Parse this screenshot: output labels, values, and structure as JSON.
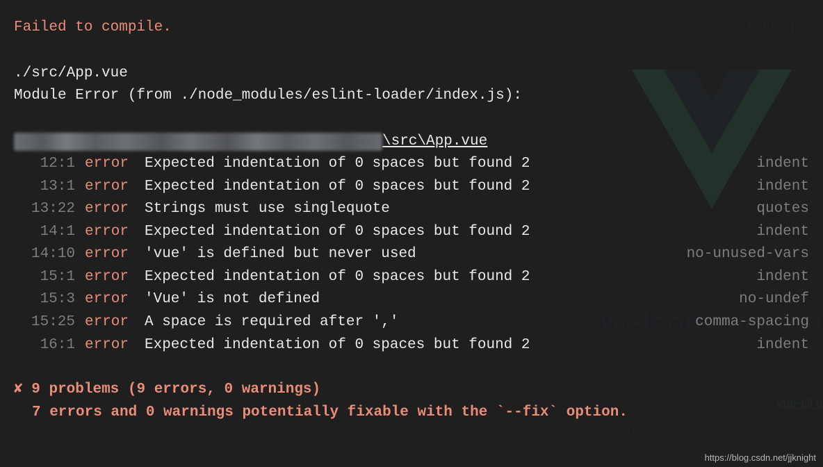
{
  "background": {
    "nav_home": "Home",
    "nav_about": "Ab",
    "nav_sep": " | ",
    "heading": "Welcome to You",
    "sub1": "For a guide and recipes on how to cor",
    "sub2_prefix": "check out the ",
    "sub2_link": "vue-cli d",
    "installed": "Installed"
  },
  "error": {
    "title": "Failed to compile.",
    "file": "./src/App.vue",
    "module_line": "Module Error (from ./node_modules/eslint-loader/index.js):",
    "path_suffix": "\\src\\App.vue",
    "rows": [
      {
        "loc": "12:1",
        "sev": "error",
        "msg": "Expected indentation of 0 spaces but found 2",
        "rule": "indent"
      },
      {
        "loc": "13:1",
        "sev": "error",
        "msg": "Expected indentation of 0 spaces but found 2",
        "rule": "indent"
      },
      {
        "loc": "13:22",
        "sev": "error",
        "msg": "Strings must use singlequote",
        "rule": "quotes"
      },
      {
        "loc": "14:1",
        "sev": "error",
        "msg": "Expected indentation of 0 spaces but found 2",
        "rule": "indent"
      },
      {
        "loc": "14:10",
        "sev": "error",
        "msg": "'vue' is defined but never used",
        "rule": "no-unused-vars"
      },
      {
        "loc": "15:1",
        "sev": "error",
        "msg": "Expected indentation of 0 spaces but found 2",
        "rule": "indent"
      },
      {
        "loc": "15:3",
        "sev": "error",
        "msg": "'Vue' is not defined",
        "rule": "no-undef"
      },
      {
        "loc": "15:25",
        "sev": "error",
        "msg": "A space is required after ','",
        "rule": "comma-spacing"
      },
      {
        "loc": "16:1",
        "sev": "error",
        "msg": "Expected indentation of 0 spaces but found 2",
        "rule": "indent"
      }
    ],
    "summary_icon": "✘",
    "summary1": "9 problems (9 errors, 0 warnings)",
    "summary2": "7 errors and 0 warnings potentially fixable with the `--fix` option."
  },
  "watermark": "https://blog.csdn.net/jjknight"
}
